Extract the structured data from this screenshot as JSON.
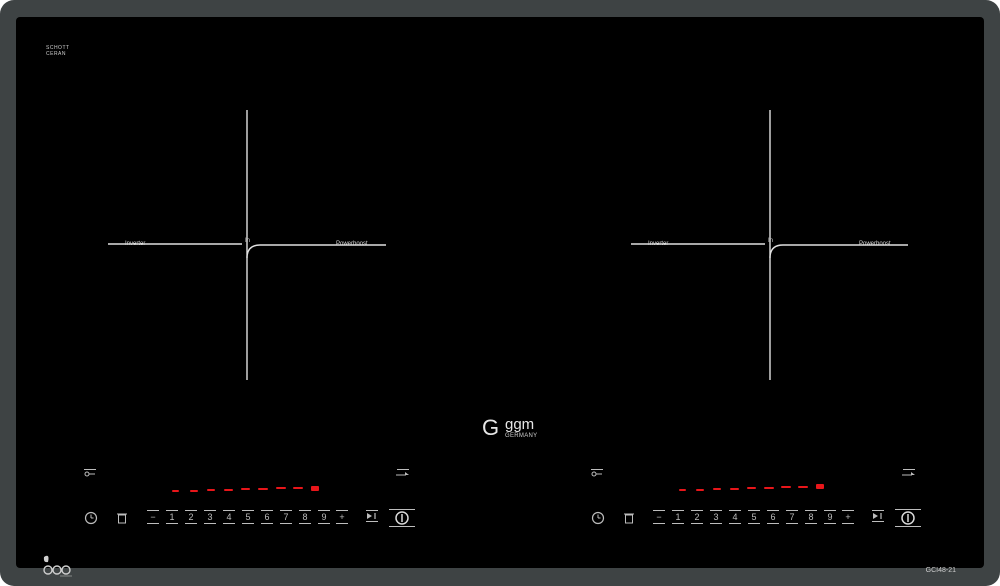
{
  "brand_top": {
    "line1": "SCHOTT",
    "line2": "CERAN"
  },
  "logo": {
    "mark": "G",
    "word": "ggm",
    "sub": "GERMANY"
  },
  "model": "GCI48-21",
  "zones": [
    {
      "labels": {
        "left": "Inverter",
        "center": "In",
        "right": "Powerboost"
      }
    },
    {
      "labels": {
        "left": "Inverter",
        "center": "In",
        "right": "Powerboost"
      }
    }
  ],
  "controls": {
    "minus": "−",
    "plus": "+",
    "levels": [
      "1",
      "2",
      "3",
      "4",
      "5",
      "6",
      "7",
      "8",
      "9"
    ]
  },
  "colors": {
    "frame": "#3e4344",
    "glass": "#000000",
    "led": "#e8161a",
    "print": "#d8d8d8"
  },
  "icons": [
    "lock-icon",
    "boost-icon",
    "timer-icon",
    "pot-icon",
    "pause-icon",
    "power-icon",
    "eco-icon"
  ]
}
